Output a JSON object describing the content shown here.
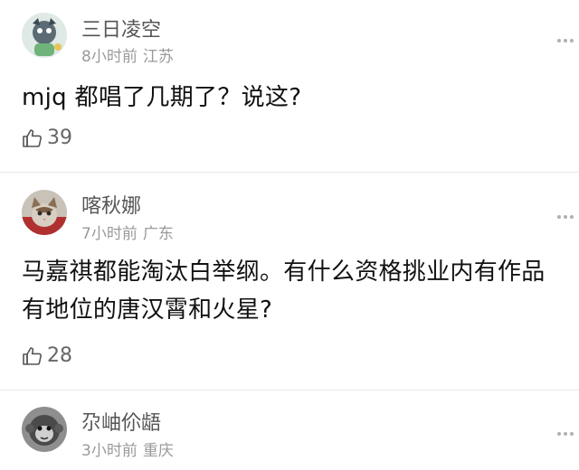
{
  "comments": [
    {
      "username": "三日凌空",
      "time": "8小时前",
      "location": "江苏",
      "content": "mjq 都唱了几期了？说这?",
      "likes": "39",
      "avatar_icon": "anime-character-avatar"
    },
    {
      "username": "喀秋娜",
      "time": "7小时前",
      "location": "广东",
      "content": "马嘉祺都能淘汰白举纲。有什么资格挑业内有作品有地位的唐汉霄和火星?",
      "likes": "28",
      "avatar_icon": "cat-photo-avatar"
    },
    {
      "username": "尕岫伱龉",
      "time": "3小时前",
      "location": "重庆",
      "avatar_icon": "monkey-photo-avatar"
    }
  ],
  "colors": {
    "username": "#555555",
    "meta": "#9a9a9a",
    "content": "#111111",
    "divider": "#e8e8e8"
  }
}
